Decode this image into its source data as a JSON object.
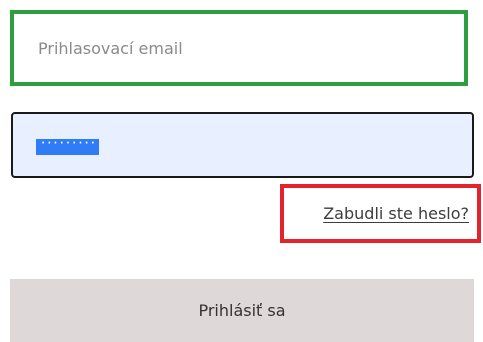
{
  "login_form": {
    "email_placeholder": "Prihlasovací email",
    "password_masked": "·········",
    "forgot_password_label": "Zabudli ste heslo?",
    "submit_label": "Prihlásiť sa"
  },
  "colors": {
    "email_highlight_border": "#2f9e41",
    "forgot_highlight_border": "#e2252d",
    "password_background": "#e8efff",
    "password_selection": "#2f7cf6",
    "button_background": "#ded8d8"
  }
}
